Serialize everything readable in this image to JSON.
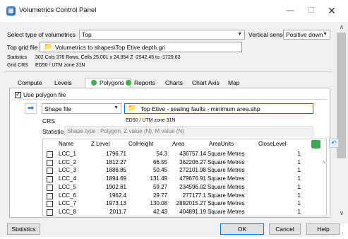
{
  "window": {
    "title": "Volumetrics Control Panel",
    "min_glyph": "—",
    "max_glyph": "☐",
    "close_glyph": "✕"
  },
  "top": {
    "select_type_label": "Select type of volumetrics",
    "select_type_value": "Top",
    "vertical_sense_label": "Vertical sense",
    "vertical_sense_value": "Positive down",
    "top_grid_label": "Top grid file",
    "top_grid_value": "Volumetrics to shapes\\Top Etive depth.gri",
    "statistics_label": "Statistics",
    "statistics_value": "302 Cols 376 Rows. Cells 25.001 x 24.954 Z -2542.45 to -1729.63",
    "grid_crs_label": "Grid CRS",
    "grid_crs_value": "ED50 / UTM zone 31N"
  },
  "tabs": [
    {
      "label": "Compute"
    },
    {
      "label": "Levels"
    },
    {
      "label": "Polygons"
    },
    {
      "label": "Reports"
    },
    {
      "label": "Charts"
    },
    {
      "label": "Chart Axis"
    },
    {
      "label": "Map"
    }
  ],
  "polygons": {
    "use_polygon_label": "Use polygon file",
    "source_type": "Shape file",
    "file_value": "Top Etive - sealing faults - minimum area.shp",
    "crs_label": "CRS",
    "crs_value": "ED50 / UTM zone 31N",
    "stats_label": "Statistics",
    "stats_value": "Shape type : Polygon, Z value (N), M value (N)"
  },
  "table": {
    "columns": [
      "Name",
      "Z Level",
      "ColHeight",
      "Area",
      "AreaUnits",
      "CloseLevel"
    ],
    "rows": [
      {
        "name": "LCC_1",
        "z": "1796.71",
        "col": "54.3",
        "area": "436757.14",
        "units": "Square Metres",
        "close": "1"
      },
      {
        "name": "LCC_2",
        "z": "1812.27",
        "col": "66.55",
        "area": "362206.27",
        "units": "Square Metres",
        "close": "1"
      },
      {
        "name": "LCC_3",
        "z": "1886.85",
        "col": "50.45",
        "area": "272101.98",
        "units": "Square Metres",
        "close": "1"
      },
      {
        "name": "LCC_4",
        "z": "1894.69",
        "col": "131.49",
        "area": "479676.91",
        "units": "Square Metres",
        "close": "1"
      },
      {
        "name": "LCC_5",
        "z": "1902.81",
        "col": "59.27",
        "area": "234596.02",
        "units": "Square Metres",
        "close": "1"
      },
      {
        "name": "LCC_6",
        "z": "1962.4",
        "col": "29.77",
        "area": "277177.1",
        "units": "Square Metres",
        "close": "1"
      },
      {
        "name": "LCC_7",
        "z": "1973.13",
        "col": "130.08",
        "area": "2892015.27",
        "units": "Square Metres",
        "close": "1"
      },
      {
        "name": "LCC_8",
        "z": "2011.7",
        "col": "42.43",
        "area": "404891.19",
        "units": "Square Metres",
        "close": "1"
      }
    ]
  },
  "footer": {
    "statistics_button": "Statistics",
    "ok_button": "OK",
    "cancel_button": "Cancel",
    "help_button": "Help"
  }
}
